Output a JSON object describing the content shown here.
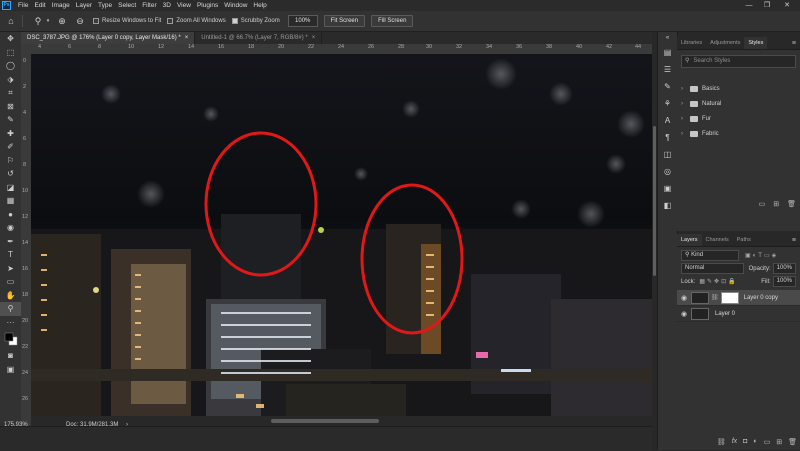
{
  "app": {
    "logo": "Ps"
  },
  "menu": [
    "File",
    "Edit",
    "Image",
    "Layer",
    "Type",
    "Select",
    "Filter",
    "3D",
    "View",
    "Plugins",
    "Window",
    "Help"
  ],
  "window_controls": {
    "minimize": "—",
    "restore": "❐",
    "close": "✕"
  },
  "options": {
    "resize_windows": "Resize Windows to Fit",
    "zoom_all": "Zoom All Windows",
    "scrubby_zoom": "Scrubby Zoom",
    "zoom_value": "100%",
    "fit_screen": "Fit Screen",
    "fill_screen": "Fill Screen"
  },
  "tabs": [
    {
      "label": "DSC_3787.JPG @ 176% (Layer 0 copy, Layer Mask/16) *",
      "close": "×"
    },
    {
      "label": "Untitled-1 @ 66.7% (Layer 7, RGB/8#) *",
      "close": "×"
    }
  ],
  "ruler_h": [
    "4",
    "6",
    "8",
    "10",
    "12",
    "14",
    "16",
    "18",
    "20",
    "22",
    "24",
    "26",
    "28",
    "30",
    "32",
    "34",
    "36",
    "38",
    "40",
    "42",
    "44"
  ],
  "ruler_v": [
    "0",
    "2",
    "4",
    "6",
    "8",
    "10",
    "12",
    "14",
    "16",
    "18",
    "20",
    "22",
    "24",
    "26"
  ],
  "status": {
    "zoom": "175.93%",
    "doc": "Doc: 31.9M/281.3M",
    "arrow": "›"
  },
  "styles_panel": {
    "tabs": [
      "Libraries",
      "Adjustments",
      "Styles"
    ],
    "menu_icon": "≡",
    "search_placeholder": "Search Styles",
    "folders": [
      "Basics",
      "Natural",
      "Fur",
      "Fabric"
    ]
  },
  "layers_panel": {
    "tabs": [
      "Layers",
      "Channels",
      "Paths"
    ],
    "menu_icon": "≡",
    "filter_kind": "Kind",
    "blend_mode": "Normal",
    "opacity_label": "Opacity:",
    "opacity_value": "100%",
    "lock_label": "Lock:",
    "fill_label": "Fill:",
    "fill_value": "100%",
    "layers": [
      {
        "name": "Layer 0 copy",
        "has_mask": true,
        "selected": true
      },
      {
        "name": "Layer 0",
        "has_mask": false,
        "selected": false
      }
    ]
  }
}
